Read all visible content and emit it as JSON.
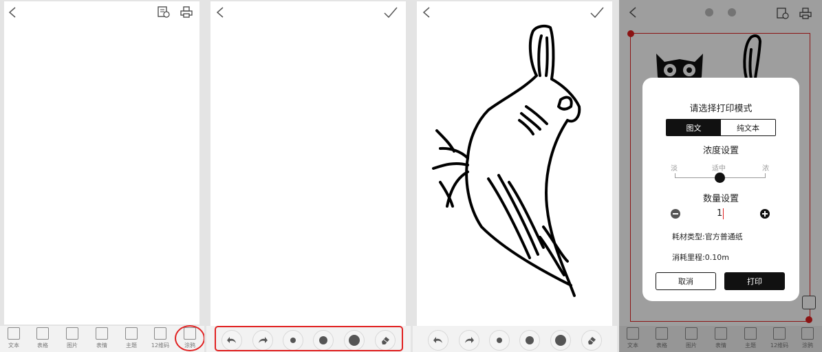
{
  "bottom_bar": {
    "items": [
      {
        "label": "文本",
        "icon": "text-icon"
      },
      {
        "label": "表格",
        "icon": "table-icon"
      },
      {
        "label": "图片",
        "icon": "image-icon"
      },
      {
        "label": "表情",
        "icon": "emoji-icon"
      },
      {
        "label": "主题",
        "icon": "theme-icon"
      },
      {
        "label": "12维码",
        "icon": "barcode-icon"
      },
      {
        "label": "涂鸦",
        "icon": "doodle-icon"
      }
    ]
  },
  "draw_tools": [
    "undo-icon",
    "redo-icon",
    "small-dot-icon",
    "medium-dot-icon",
    "large-dot-icon",
    "eraser-icon"
  ],
  "dialog": {
    "title": "请选择打印模式",
    "mode_tabs": [
      "图文",
      "纯文本"
    ],
    "selected_mode": "图文",
    "density_title": "浓度设置",
    "density_labels": [
      "淡",
      "适中",
      "浓"
    ],
    "density_value": "适中",
    "quantity_title": "数量设置",
    "quantity_value": "1",
    "material": "耗材类型:官方普通纸",
    "mileage": "消耗里程:0.10m",
    "cancel": "取消",
    "print": "打印"
  },
  "colors": {
    "accent": "#e02020",
    "dark": "#111111"
  }
}
